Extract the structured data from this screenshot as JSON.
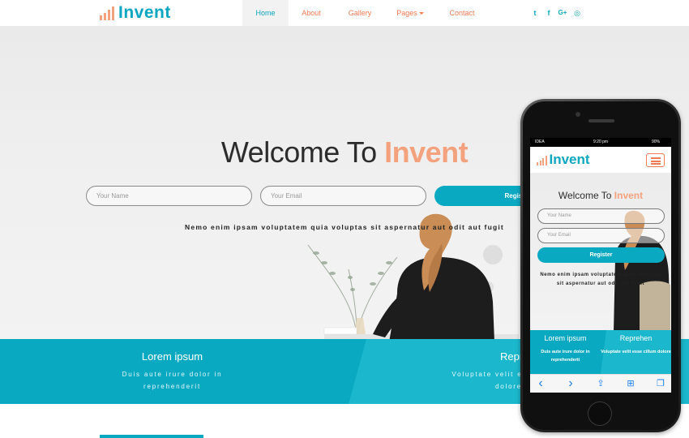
{
  "brand": {
    "name": "Invent",
    "accent": "#0ba6bf",
    "orange": "#f27a53",
    "peach": "#f4a27e"
  },
  "nav": {
    "items": [
      {
        "label": "Home",
        "active": true
      },
      {
        "label": "About"
      },
      {
        "label": "Gallery"
      },
      {
        "label": "Pages"
      },
      {
        "label": "Contact"
      }
    ],
    "social": [
      {
        "icon": "twitter-icon",
        "glyph": "t"
      },
      {
        "icon": "facebook-icon",
        "glyph": "f"
      },
      {
        "icon": "google-plus-icon",
        "glyph": "G+"
      },
      {
        "icon": "dribbble-icon",
        "glyph": "◎"
      }
    ]
  },
  "hero": {
    "title_prefix": "Welcome To",
    "title_accent": "Invent",
    "name_placeholder": "Your Name",
    "email_placeholder": "Your Email",
    "register_label": "Register",
    "tagline": "Nemo enim ipsam voluptatem quia voluptas sit aspernatur aut odit aut fugit"
  },
  "features": [
    {
      "title": "Lorem ipsum",
      "text": "Duis aute irure dolor in reprehenderit"
    },
    {
      "title": "Reprehen",
      "text": "Voluptate velit esse cillum dolore"
    }
  ],
  "phone": {
    "status": {
      "carrier": "IDEA",
      "time": "9:20 pm",
      "battery": "90%"
    },
    "hero": {
      "title_prefix": "Welcome To",
      "title_accent": "Invent",
      "name_placeholder": "Your Name",
      "email_placeholder": "Your Email",
      "register_label": "Register",
      "tagline": "Nemo enim ipsam voluptatem quia voluptas sit aspernatur aut odit aut fugit"
    },
    "features": [
      {
        "title": "Lorem ipsum",
        "text": "Duis aute irure dolor in reprehenderit"
      },
      {
        "title": "Reprehen",
        "text": "Voluptate velit esse cillum dolore"
      }
    ],
    "toolbar": [
      {
        "icon": "back-icon",
        "glyph": "‹"
      },
      {
        "icon": "forward-icon",
        "glyph": "›"
      },
      {
        "icon": "share-icon",
        "glyph": "⇪"
      },
      {
        "icon": "bookmarks-icon",
        "glyph": "⊞"
      },
      {
        "icon": "tabs-icon",
        "glyph": "❐"
      }
    ]
  }
}
